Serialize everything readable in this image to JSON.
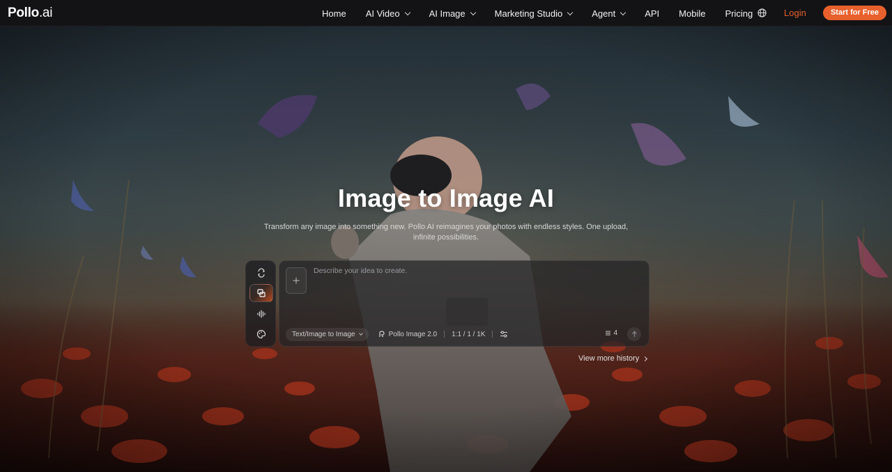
{
  "brand": {
    "name": "Pollo",
    "suffix": ".ai"
  },
  "nav": {
    "items": [
      {
        "label": "Home",
        "has_menu": false
      },
      {
        "label": "AI Video",
        "has_menu": true
      },
      {
        "label": "AI Image",
        "has_menu": true
      },
      {
        "label": "Marketing Studio",
        "has_menu": true
      },
      {
        "label": "Agent",
        "has_menu": true
      },
      {
        "label": "API",
        "has_menu": false
      },
      {
        "label": "Mobile",
        "has_menu": false
      },
      {
        "label": "Pricing",
        "has_menu": false
      }
    ],
    "language_icon": "globe-icon",
    "login_label": "Login",
    "cta_label": "Start for Free"
  },
  "hero": {
    "title": "Image to Image AI",
    "subtitle": "Transform any image into something new. Pollo AI reimagines your photos with endless styles. One upload, infinite possibilities."
  },
  "tool": {
    "modes": [
      {
        "icon": "video-swap-icon",
        "active": false
      },
      {
        "icon": "image-swap-icon",
        "active": true
      },
      {
        "icon": "audio-wave-icon",
        "active": false
      },
      {
        "icon": "palette-icon",
        "active": false
      }
    ],
    "add_icon": "plus-icon",
    "prompt_placeholder": "Describe your idea to create.",
    "mode_select": "Text/Image to Image",
    "model_label": "Pollo Image 2.0",
    "settings_summary": "1:1 / 1 / 1K",
    "settings_icon": "sliders-icon",
    "output_count": "4",
    "send_icon": "arrow-up-icon",
    "history_label": "View more history"
  },
  "colors": {
    "accent": "#e8602c",
    "nav_bg": "#131316"
  }
}
